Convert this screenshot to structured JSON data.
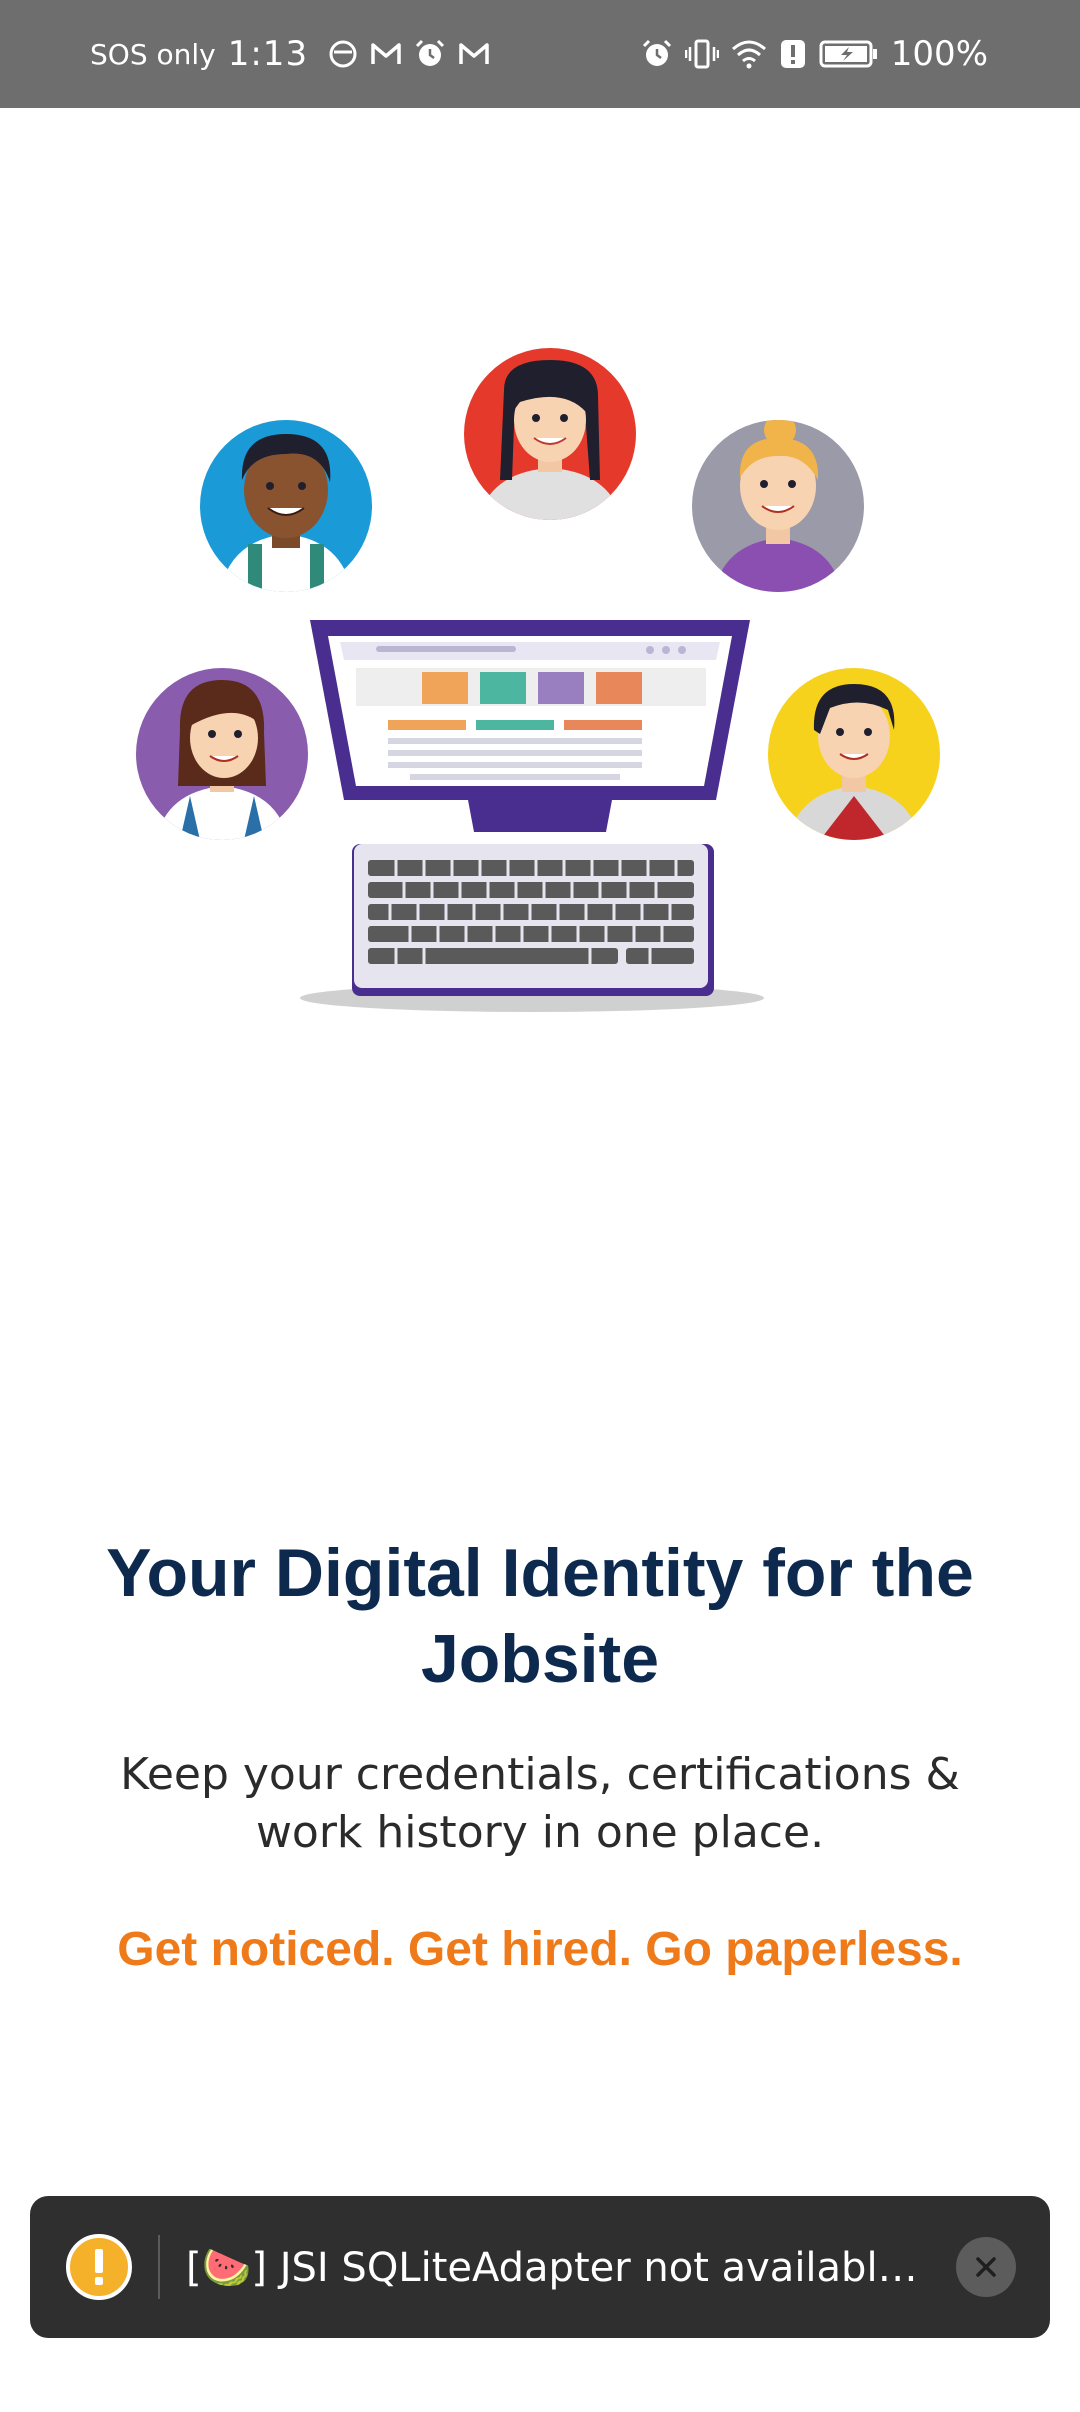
{
  "status_bar": {
    "carrier": "SOS only",
    "time": "1:13",
    "battery": "100%",
    "icons_left": [
      "app-notification-icon",
      "gmail-icon",
      "alarm-icon",
      "gmail-icon"
    ],
    "icons_right": [
      "alarm-icon",
      "vibrate-icon",
      "wifi-icon",
      "alert-icon",
      "battery-charging-icon"
    ]
  },
  "onboarding": {
    "title": "Your Digital Identity for the Jobsite",
    "subtitle": "Keep your credentials, certifications & work history in one place.",
    "tagline": "Get noticed. Get hired. Go paperless."
  },
  "toast": {
    "emoji": "🍉",
    "message": "[🍉] JSI SQLiteAdapter not available…",
    "icon": "warning-icon",
    "close_icon": "close-icon"
  },
  "colors": {
    "title": "#0d2a4e",
    "tagline": "#ef7a1a",
    "status_bar": "#6e6e6e",
    "toast_bg": "#2f2f2f",
    "warning": "#f6b12a",
    "monitor": "#4a2e8f"
  }
}
